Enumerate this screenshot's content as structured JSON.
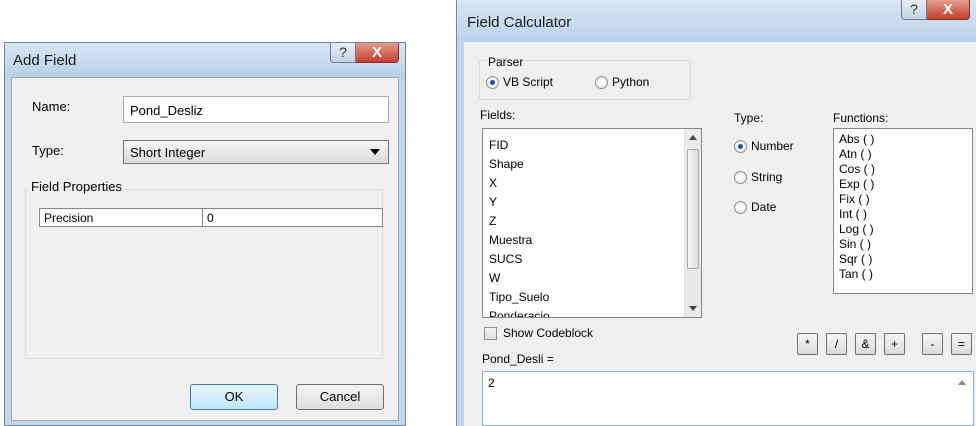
{
  "add_field": {
    "title": "Add Field",
    "help_icon_glyph": "?",
    "close_icon_glyph": "X",
    "name_label": "Name:",
    "name_value": "Pond_Desliz",
    "type_label": "Type:",
    "type_value": "Short Integer",
    "field_properties_label": "Field Properties",
    "properties": [
      {
        "name": "Precision",
        "value": "0"
      }
    ],
    "ok_label": "OK",
    "cancel_label": "Cancel"
  },
  "field_calculator": {
    "title": "Field Calculator",
    "help_icon_glyph": "?",
    "close_icon_glyph": "X",
    "parser_label": "Parser",
    "parser_options": [
      "VB Script",
      "Python"
    ],
    "parser_selected": "VB Script",
    "fields_label": "Fields:",
    "fields": [
      "FID",
      "Shape",
      "X",
      "Y",
      "Z",
      "Muestra",
      "SUCS",
      "W",
      "Tipo_Suelo",
      "Ponderacio"
    ],
    "type_label": "Type:",
    "type_options": [
      "Number",
      "String",
      "Date"
    ],
    "type_selected": "Number",
    "functions_label": "Functions:",
    "functions": [
      "Abs ( )",
      "Atn ( )",
      "Cos ( )",
      "Exp ( )",
      "Fix ( )",
      "Int ( )",
      "Log ( )",
      "Sin ( )",
      "Sqr ( )",
      "Tan ( )"
    ],
    "show_codeblock_label": "Show Codeblock",
    "show_codeblock_checked": false,
    "operators": [
      "*",
      "/",
      "&",
      "+",
      "-",
      "="
    ],
    "expression_label": "Pond_Desli =",
    "expression_value": "2"
  },
  "colors": {
    "title_bar": "#c2d6ea",
    "close_button": "#c2402c",
    "dialog_body": "#f0f0f0"
  }
}
